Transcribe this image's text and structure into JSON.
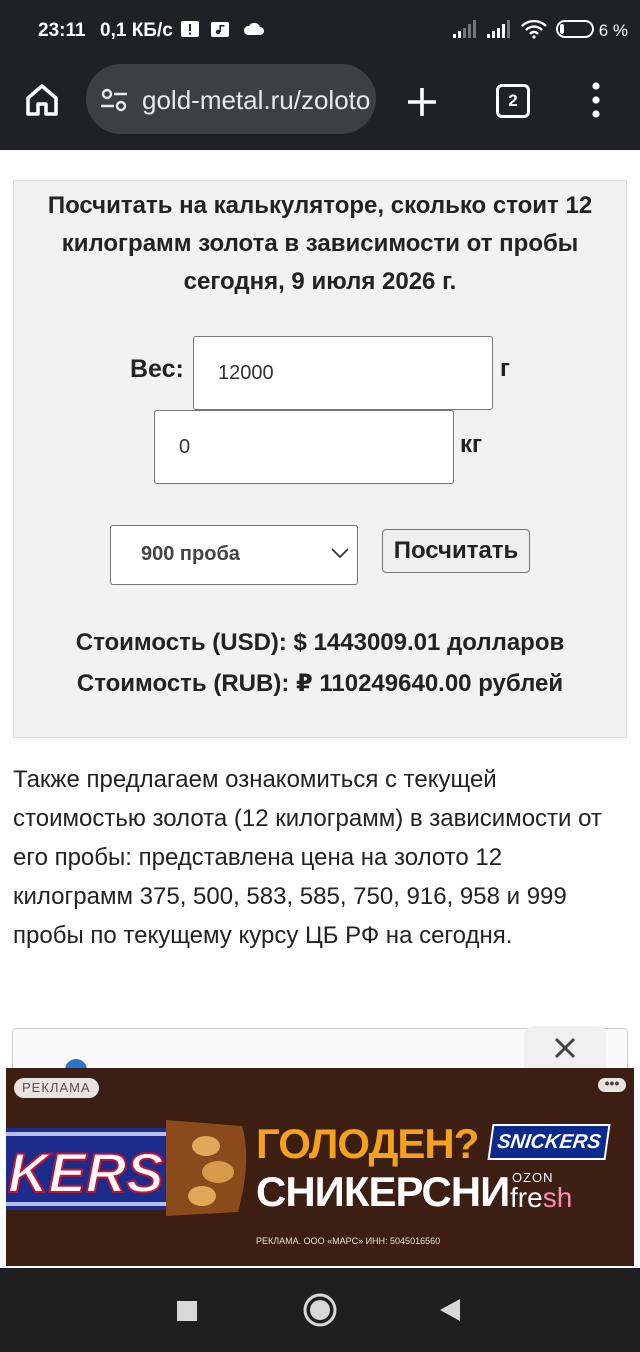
{
  "status_bar": {
    "time": "23:11",
    "net_speed": "0,1 КБ/с",
    "battery": "6 %",
    "icons": [
      "alert-icon",
      "media-icon",
      "cloud-icon",
      "signal-icon",
      "signal-icon",
      "wifi-icon",
      "battery-icon"
    ]
  },
  "browser": {
    "url": "gold-metal.ru/zoloto",
    "tab_count": "2",
    "icons": [
      "home-icon",
      "tune-icon",
      "plus-icon",
      "tabs-icon",
      "more-icon"
    ]
  },
  "calculator": {
    "title": "Посчитать на калькуляторе, сколько стоит 12 килограмм золота в зависимости от пробы сегодня, 9 июля 2026 г.",
    "weight_label": "Вес:",
    "grams_value": "12000",
    "grams_unit": "г",
    "kg_value": "0",
    "kg_unit": "кг",
    "purity_selected": "900 проба",
    "calc_button": "Посчитать",
    "result_usd": "Стоимость (USD): $ 1443009.01 долларов",
    "result_rub": "Стоимость (RUB): ₽ 110249640.00 рублей"
  },
  "paragraph": "Также предлагаем ознакомиться с текущей стоимостью золота (12 килограмм) в зависимости от его пробы: представлена цена на золото 12 килограмм 375, 500, 583, 585, 750, 916, 958 и 999 пробы по текущему курсу ЦБ РФ на сегодня.",
  "ad": {
    "badge": "РЕКЛАМА",
    "bar_text": "KERS",
    "headline": "ГОЛОДЕН?",
    "subheadline": "СНИКЕРСНИ",
    "brand": "SNICKERS",
    "ozon": "OZON",
    "fresh_a": "fre",
    "fresh_b": "sh",
    "legal": "РЕКЛАМА. ООО «МАРС» ИНН: 5045016560",
    "colors": {
      "background": "#3c1f12",
      "headline": "#f4a020"
    }
  },
  "nav": {
    "icons": [
      "recents-icon",
      "home-circle-icon",
      "back-icon"
    ]
  }
}
